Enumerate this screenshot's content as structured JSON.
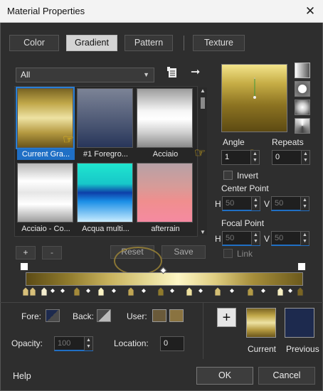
{
  "window": {
    "title": "Material Properties",
    "close_glyph": "✕"
  },
  "tabs": [
    {
      "label": "Color"
    },
    {
      "label": "Gradient"
    },
    {
      "label": "Pattern"
    },
    {
      "label": "Texture"
    }
  ],
  "category_select": {
    "value": "All"
  },
  "gallery": [
    {
      "label": "Current Gra..."
    },
    {
      "label": "#1 Foregro..."
    },
    {
      "label": "Acciaio"
    },
    {
      "label": "Acciaio - Co..."
    },
    {
      "label": "Acqua multi..."
    },
    {
      "label": "afterrain"
    }
  ],
  "gallery_buttons": {
    "add": "+",
    "remove": "-",
    "reset": "Reset",
    "save": "Save"
  },
  "repeats_label": "Repeats",
  "angle": {
    "label": "Angle",
    "value": "1"
  },
  "repeats": {
    "value": "0"
  },
  "invert": {
    "label": "Invert"
  },
  "center_point": {
    "label": "Center Point",
    "h_label": "H",
    "h": "50",
    "v_label": "V",
    "v": "50"
  },
  "focal_point": {
    "label": "Focal Point",
    "h_label": "H",
    "h": "50",
    "v_label": "V",
    "v": "50"
  },
  "link": {
    "label": "Link"
  },
  "bottom": {
    "fore_label": "Fore:",
    "back_label": "Back:",
    "user_label": "User:",
    "opacity_label": "Opacity:",
    "opacity_value": "100",
    "location_label": "Location:",
    "location_value": "0",
    "add_glyph": "+",
    "current_label": "Current",
    "previous_label": "Previous"
  },
  "footer": {
    "help": "Help",
    "ok": "OK",
    "cancel": "Cancel"
  },
  "colors": {
    "accent": "#1f6fc5",
    "gold_light": "#f3e48b",
    "gold_dark": "#5d4a12",
    "previous_swatch": "#1d2a4e"
  }
}
